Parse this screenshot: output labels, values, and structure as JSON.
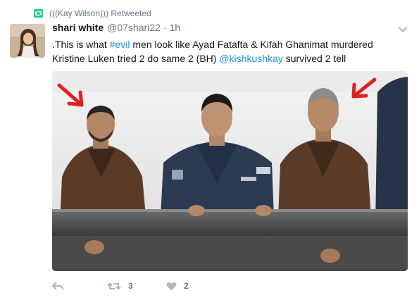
{
  "retweet": {
    "label": "(((Kay Wilson))) Retweeted"
  },
  "author": {
    "name": "shari white",
    "handle": "@07shari22",
    "separator": "·",
    "time": "1h"
  },
  "tweet": {
    "text_1": ".This is what ",
    "hashtag": "#evil",
    "text_2": " men look like Ayad Fatafta & Kifah Ghanimat murdered Kristine Luken tried 2 do same 2 (BH) ",
    "mention": "@kishkushkay",
    "text_3": " survived 2 tell"
  },
  "actions": {
    "reply_icon": "reply-icon",
    "retweets": "3",
    "likes": "2"
  },
  "colors": {
    "link": "#1b95e0",
    "muted": "#657786",
    "text": "#14171a",
    "retweet_badge": "#19cf86",
    "arrow": "#e02020"
  }
}
